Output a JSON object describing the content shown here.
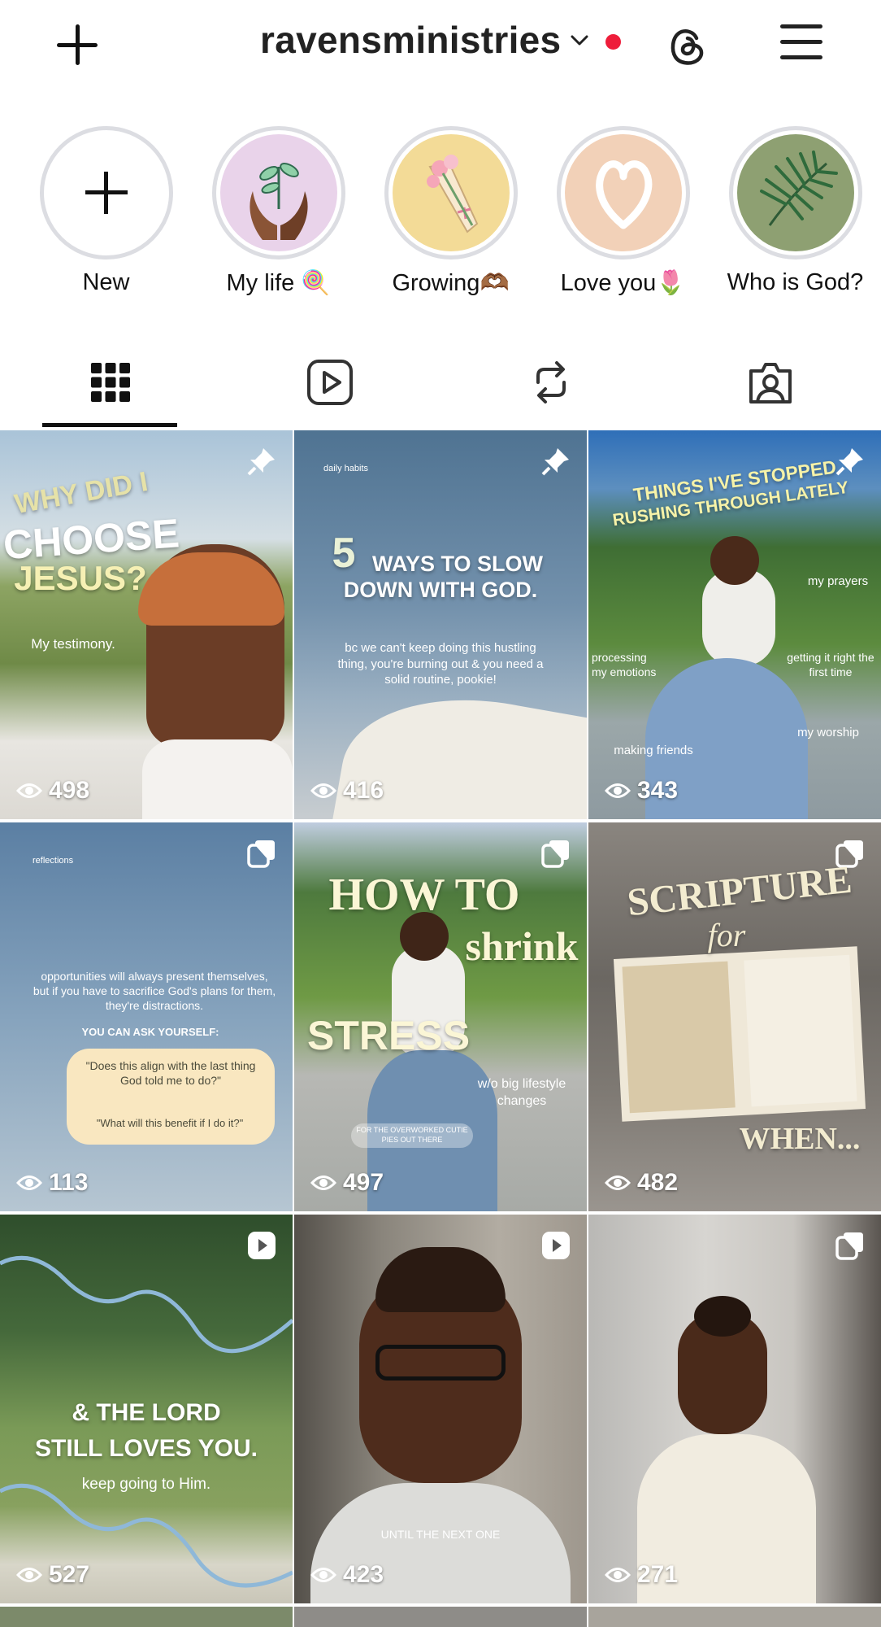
{
  "header": {
    "username": "ravensministries",
    "icons": [
      "plus-icon",
      "chevron-down-icon",
      "notification-dot",
      "threads-icon",
      "menu-icon"
    ],
    "accent_red": "#ee1d3a"
  },
  "stories": [
    {
      "label": "New",
      "type": "new"
    },
    {
      "label": "My life 🍭",
      "bg": "#e9d3ea"
    },
    {
      "label": "Growing🫶🏾",
      "bg": "#f3db97"
    },
    {
      "label": "Love you🌷",
      "bg": "#f2d1b8"
    },
    {
      "label": "Who is God?",
      "bg": "#8ea072"
    }
  ],
  "tabs": [
    {
      "name": "grid",
      "icon": "grid-icon",
      "active": true
    },
    {
      "name": "reels",
      "icon": "reels-icon"
    },
    {
      "name": "reposts",
      "icon": "repost-icon"
    },
    {
      "name": "tagged",
      "icon": "tagged-icon"
    }
  ],
  "posts": [
    {
      "views": "498",
      "badge": "pin",
      "title1": "WHY DID I",
      "title2": "CHOOSE",
      "title3": "JESUS?",
      "sub": "My testimony."
    },
    {
      "views": "416",
      "badge": "pin",
      "top_left": "daily habits",
      "title1": "5",
      "title2": "WAYS TO SLOW",
      "title3": "DOWN WITH GOD.",
      "sub": "bc we can't keep doing this hustling thing, you're burning out & you need a solid routine, pookie!"
    },
    {
      "views": "343",
      "badge": "pin",
      "title1": "THINGS I'VE STOPPED",
      "title2": "RUSHING THROUGH LATELY",
      "labels": [
        "my prayers",
        "processing my emotions",
        "getting it right the first time",
        "my worship",
        "making friends"
      ]
    },
    {
      "views": "113",
      "badge": "carousel",
      "top_left": "reflections",
      "sub": "opportunities will always present themselves, but if you have to sacrifice God's plans for them, they're distractions.",
      "ask": "YOU CAN ASK YOURSELF:",
      "q1": "\"Does this align with the last thing God told me to do?\"",
      "q2": "\"What will this benefit if I do it?\""
    },
    {
      "views": "497",
      "badge": "carousel",
      "title1": "HOW TO",
      "title2": "shrink",
      "title3": "STRESS",
      "sub": "w/o big lifestyle changes",
      "pill": "FOR THE OVERWORKED CUTIE PIES OUT THERE"
    },
    {
      "views": "482",
      "badge": "carousel",
      "title1": "SCRIPTURE",
      "title2": "for",
      "title3": "WHEN..."
    },
    {
      "views": "527",
      "badge": "reel",
      "title1": "& THE LORD",
      "title2": "STILL LOVES YOU.",
      "sub": "keep going to Him."
    },
    {
      "views": "423",
      "badge": "reel",
      "caption": "UNTIL THE NEXT ONE"
    },
    {
      "views": "271",
      "badge": "carousel"
    }
  ]
}
